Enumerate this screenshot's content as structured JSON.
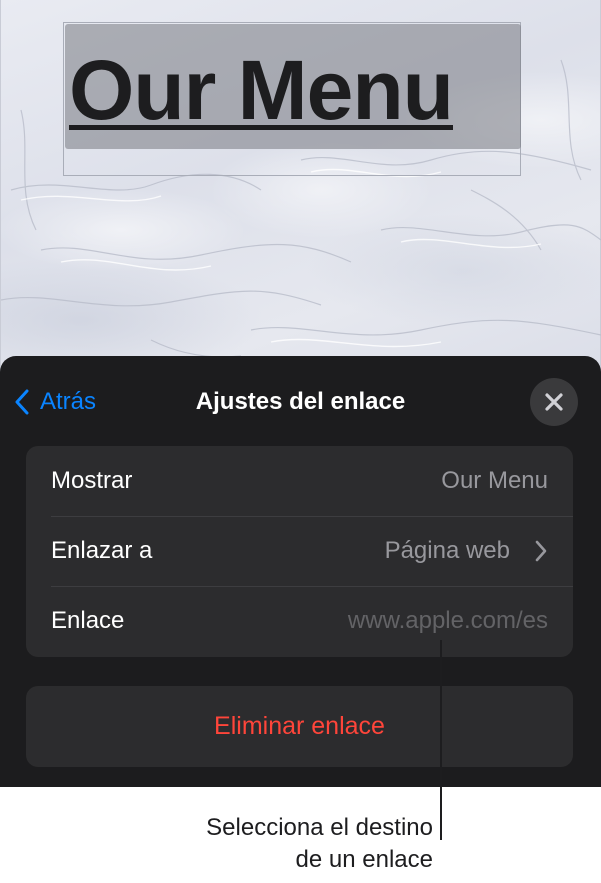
{
  "document": {
    "title_text": "Our Menu"
  },
  "sheet": {
    "back_label": "Atrás",
    "title": "Ajustes del enlace",
    "close_icon": "xmark-icon",
    "rows": [
      {
        "label": "Mostrar",
        "value": "Our Menu"
      },
      {
        "label": "Enlazar a",
        "value": "Página web",
        "has_chevron": true
      },
      {
        "label": "Enlace",
        "value": "www.apple.com/es"
      }
    ],
    "remove_label": "Eliminar enlace"
  },
  "callout": {
    "line1": "Selecciona el destino",
    "line2": "de un enlace"
  },
  "colors": {
    "accent": "#0a84ff",
    "destructive": "#ff453a",
    "sheet_bg": "#1c1c1e",
    "group_bg": "#2c2c2e"
  }
}
